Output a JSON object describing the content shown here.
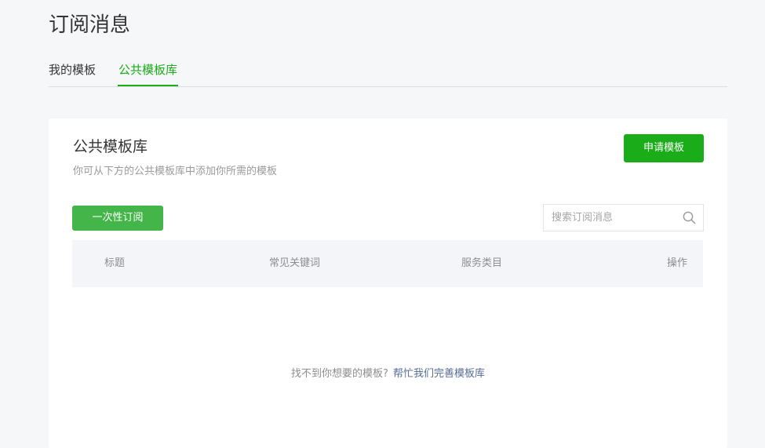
{
  "header": {
    "title": "订阅消息"
  },
  "tabs": [
    {
      "label": "我的模板",
      "active": false
    },
    {
      "label": "公共模板库",
      "active": true
    }
  ],
  "card": {
    "title": "公共模板库",
    "description": "你可从下方的公共模板库中添加你所需的模板",
    "apply_button_label": "申请模板",
    "onetime_button_label": "一次性订阅"
  },
  "search": {
    "placeholder": "搜索订阅消息",
    "value": "",
    "icon": "search-icon"
  },
  "table": {
    "columns": [
      "标题",
      "常见关键词",
      "服务类目",
      "操作"
    ],
    "rows": []
  },
  "empty_state": {
    "text": "找不到你想要的模板?",
    "link_label": "帮忙我们完善模板库"
  },
  "colors": {
    "accent": "#1aad19",
    "onetime_button": "#44b549",
    "link": "#576b95",
    "page_background": "#f6f7f8",
    "table_header_background": "#f4f5f9"
  }
}
